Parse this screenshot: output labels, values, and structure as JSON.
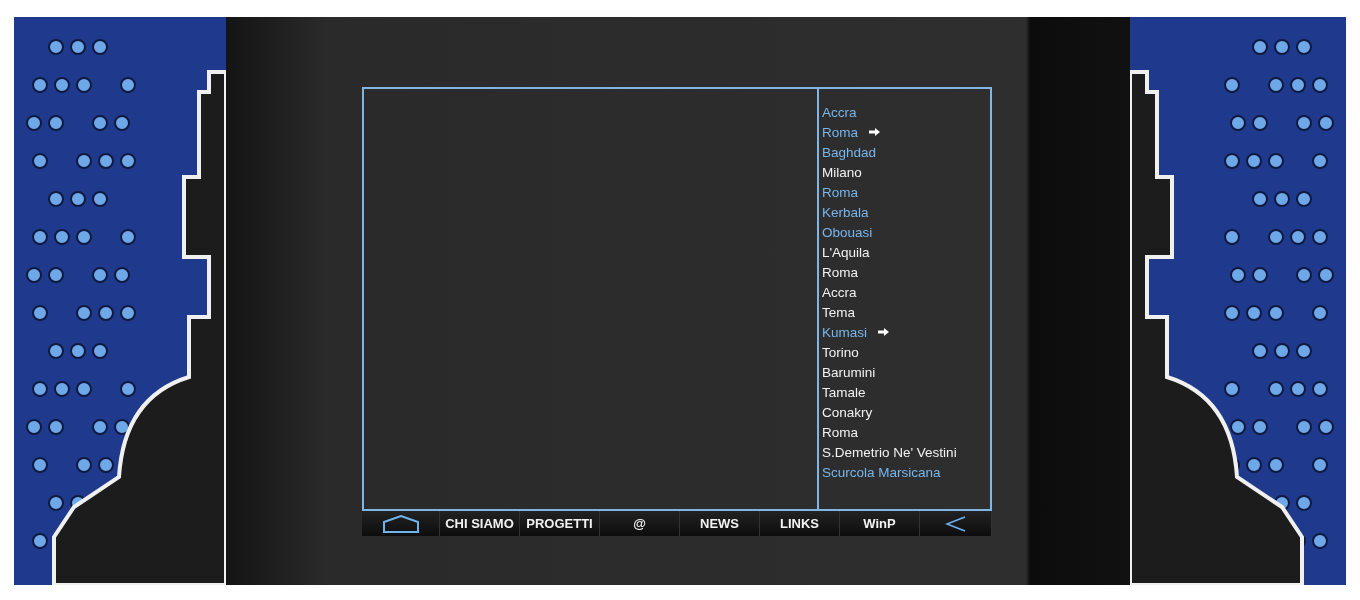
{
  "places": [
    {
      "label": "Accra",
      "kind": "link",
      "arrow": false
    },
    {
      "label": "Roma",
      "kind": "link",
      "arrow": true
    },
    {
      "label": "Baghdad",
      "kind": "link",
      "arrow": false
    },
    {
      "label": "Milano",
      "kind": "plain",
      "arrow": false
    },
    {
      "label": "Roma",
      "kind": "link",
      "arrow": false
    },
    {
      "label": "Kerbala",
      "kind": "link",
      "arrow": false
    },
    {
      "label": "Obouasi",
      "kind": "link",
      "arrow": false
    },
    {
      "label": "L'Aquila",
      "kind": "plain",
      "arrow": false
    },
    {
      "label": "Roma",
      "kind": "plain",
      "arrow": false
    },
    {
      "label": "Accra",
      "kind": "plain",
      "arrow": false
    },
    {
      "label": "Tema",
      "kind": "plain",
      "arrow": false
    },
    {
      "label": "Kumasi",
      "kind": "link",
      "arrow": true
    },
    {
      "label": "Torino",
      "kind": "plain",
      "arrow": false
    },
    {
      "label": "Barumini",
      "kind": "plain",
      "arrow": false
    },
    {
      "label": "Tamale",
      "kind": "plain",
      "arrow": false
    },
    {
      "label": "Conakry",
      "kind": "plain",
      "arrow": false
    },
    {
      "label": "Roma",
      "kind": "plain",
      "arrow": false
    },
    {
      "label": "S.Demetrio Ne' Vestini",
      "kind": "plain",
      "arrow": false
    },
    {
      "label": "Scurcola Marsicana",
      "kind": "link",
      "arrow": false
    }
  ],
  "nav": [
    {
      "kind": "home"
    },
    {
      "kind": "text",
      "label": "CHI SIAMO"
    },
    {
      "kind": "text",
      "label": "PROGETTI"
    },
    {
      "kind": "text",
      "label": "@"
    },
    {
      "kind": "text",
      "label": "NEWS"
    },
    {
      "kind": "text",
      "label": "LINKS"
    },
    {
      "kind": "text",
      "label": "WinP"
    },
    {
      "kind": "back"
    }
  ]
}
